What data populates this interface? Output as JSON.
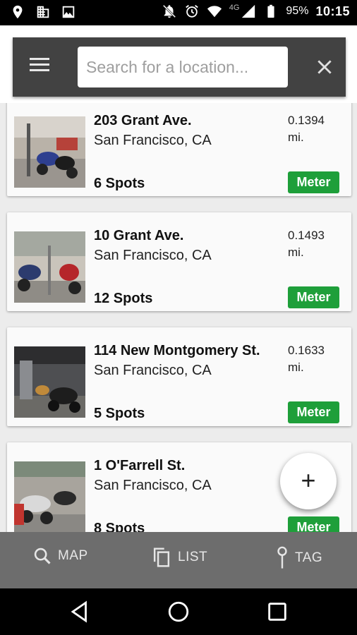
{
  "status_bar": {
    "battery_percent": "95%",
    "time": "10:15",
    "network": "4G"
  },
  "search": {
    "placeholder": "Search for a location..."
  },
  "locations": [
    {
      "address": "203 Grant Ave.",
      "city": "San Francisco, CA",
      "distance": "0.1394",
      "distance_unit": "mi.",
      "spots": "6 Spots",
      "type": "Meter"
    },
    {
      "address": "10 Grant Ave.",
      "city": "San Francisco, CA",
      "distance": "0.1493",
      "distance_unit": "mi.",
      "spots": "12 Spots",
      "type": "Meter"
    },
    {
      "address": "114 New Montgomery St.",
      "city": "San Francisco, CA",
      "distance": "0.1633",
      "distance_unit": "mi.",
      "spots": "5 Spots",
      "type": "Meter"
    },
    {
      "address": "1 O'Farrell St.",
      "city": "San Francisco, CA",
      "distance": "",
      "distance_unit": "",
      "spots": "8 Spots",
      "type": "Meter"
    }
  ],
  "fab": {
    "label": "+"
  },
  "bottom_nav": [
    {
      "label": "MAP",
      "icon": "search-icon"
    },
    {
      "label": "LIST",
      "icon": "copy-icon"
    },
    {
      "label": "TAG",
      "icon": "pin-icon"
    }
  ],
  "colors": {
    "meter_badge": "#1e9f3a",
    "toolbar": "#424242",
    "bottom_nav": "#6d6d6d"
  }
}
